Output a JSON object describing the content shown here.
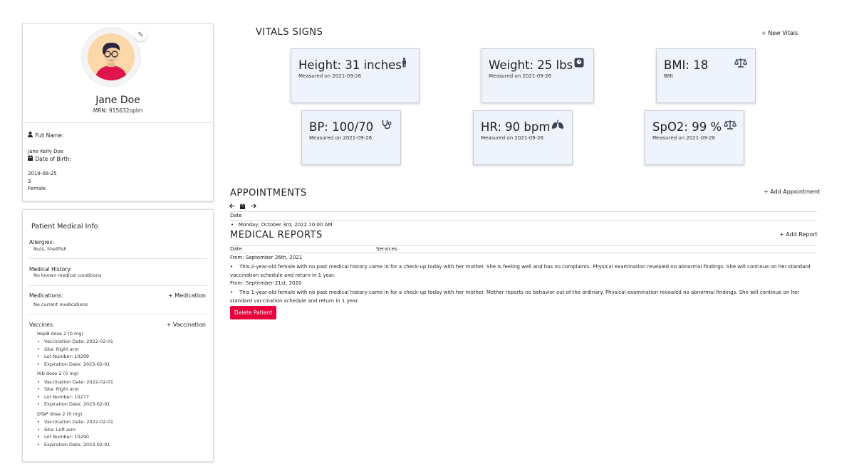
{
  "profile": {
    "name": "Jane Doe",
    "mrn": "MRN: 915632oplm",
    "full_name_label": "Full Name:",
    "full_name": "Jane Kelly Doe",
    "dob_label": "Date of Birth:",
    "dob": "2019-08-25",
    "age": "3",
    "sex": "Female"
  },
  "medical_info": {
    "title": "Patient Medical Info",
    "allergies_label": "Allergies:",
    "allergies": "Nuts, Shellfish",
    "history_label": "Medical History:",
    "history": "No known medical conditions",
    "medications_label": "Medications:",
    "medications": "No current medications",
    "add_medication": "+ Medication",
    "vaccines_label": "Vaccines:",
    "add_vaccination": "+ Vaccination",
    "vaccines": [
      {
        "name": "HepB dose 2 (0 mg)",
        "date": "Vaccination Date: 2022-02-01",
        "site": "Site: Right arm",
        "lot": "Lot Number: 10299",
        "exp": "Expiration Date: 2023-02-01"
      },
      {
        "name": "Hib dose 2 (0 mg)",
        "date": "Vaccination Date: 2022-02-01",
        "site": "Site: Right arm",
        "lot": "Lot Number: 10277",
        "exp": "Expiration Date: 2023-02-01"
      },
      {
        "name": "DTaP dose 2 (0 mg)",
        "date": "Vaccination Date: 2022-02-01",
        "site": "Site: Left arm",
        "lot": "Lot Number: 10290",
        "exp": "Expiration Date: 2023-02-01"
      }
    ]
  },
  "vitals": {
    "title": "VITALS SIGNS",
    "new_vitals": "+ New Vitals",
    "cards": [
      {
        "value": "Height: 31 inches",
        "sub": "Measured on 2021-09-26",
        "icon": "person-standing-icon"
      },
      {
        "value": "Weight: 25 lbs",
        "sub": "Measured on 2021-09-26",
        "icon": "weight-scale-icon"
      },
      {
        "value": "BMI: 18",
        "sub": "BMI",
        "icon": "balance-scale-icon"
      },
      {
        "value": "BP: 100/70",
        "sub": "Measured on 2021-09-26",
        "icon": "stethoscope-icon"
      },
      {
        "value": "HR: 90 bpm",
        "sub": "Measured on 2021-09-26",
        "icon": "lungs-icon"
      },
      {
        "value": "SpO2: 99 %",
        "sub": "Measured on 2021-09-26",
        "icon": "balance-scale-icon"
      }
    ]
  },
  "appointments": {
    "title": "APPOINTMENTS",
    "add": "+ Add Appointment",
    "date_header": "Date",
    "items": [
      "Monday, October 3rd, 2022 10:00 AM"
    ]
  },
  "reports": {
    "title": "MEDICAL REPORTS",
    "add": "+ Add Report",
    "col_date": "Date",
    "col_services": "Services",
    "items": [
      {
        "from": "From: September 26th, 2021",
        "text": "This 2-year-old female with no past medical history came in for a check-up today with her mother. She is feeling well and has no complaints. Physical examination revealed no abnormal findings. She will continue on her standard vaccination schedule and return in 1 year."
      },
      {
        "from": "From: September 21st, 2020",
        "text": "This 1-year-old female with no past medical history came in for a check-up today with her mother. Mother reports no behavior out of the ordinary. Physical examination revealed no abnormal findings. She will continue on her standard vaccination schedule and return in 1 year."
      }
    ]
  },
  "delete_button": "Delete Patient",
  "colors": {
    "accent_red": "#e8003c",
    "vital_bg": "#eff3fc",
    "avatar_shirt": "#e0144c"
  }
}
